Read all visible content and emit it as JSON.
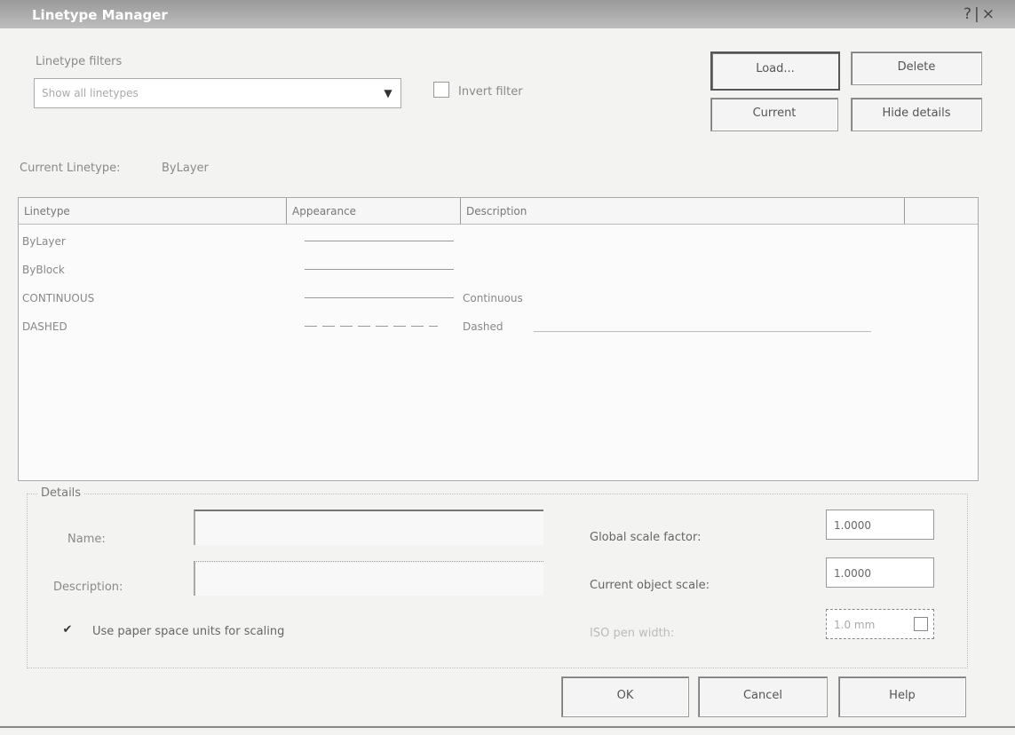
{
  "window": {
    "title": "Linetype Manager",
    "controls": "?|×"
  },
  "filter": {
    "label": "Linetype filters",
    "selected": "Show all linetypes",
    "invert_label": "Invert filter",
    "invert_checked": false
  },
  "buttons": {
    "load": "Load...",
    "delete": "Delete",
    "current": "Current",
    "hide_details": "Hide details",
    "ok": "OK",
    "cancel": "Cancel",
    "help": "Help"
  },
  "current_linetype": {
    "label": "Current Linetype:",
    "value": "ByLayer"
  },
  "list": {
    "columns": [
      "Linetype",
      "Appearance",
      "Description"
    ],
    "rows": [
      {
        "name": "ByLayer",
        "description": ""
      },
      {
        "name": "ByBlock",
        "description": ""
      },
      {
        "name": "CONTINUOUS",
        "description": "Continuous"
      },
      {
        "name": "DASHED",
        "description": "Dashed"
      }
    ]
  },
  "details": {
    "title": "Details",
    "name_label": "Name:",
    "name_value": "",
    "description_label": "Description:",
    "description_value": "",
    "paper_space_label": "Use paper space units for scaling",
    "paper_space_checked": true,
    "global_scale_label": "Global scale factor:",
    "global_scale_value": "1.0000",
    "current_scale_label": "Current object scale:",
    "current_scale_value": "1.0000",
    "iso_pen_label": "ISO pen width:",
    "iso_pen_value": "1.0 mm"
  }
}
